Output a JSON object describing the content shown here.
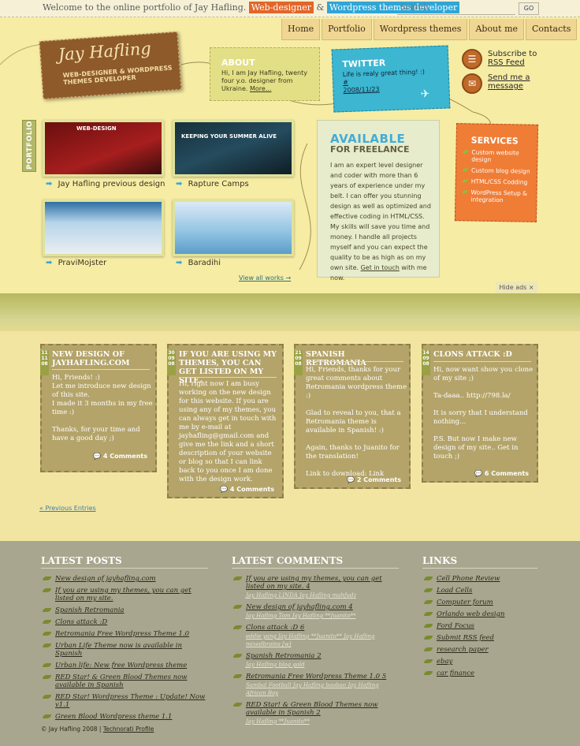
{
  "top": {
    "welcome": "Welcome to the online portfolio of Jay Hafling.",
    "role1": "Web-designer",
    "amp": "&",
    "role2": "Wordpress themes developer",
    "search_label": "Search",
    "go": "GO",
    "colors": {
      "role1": "#e2662a",
      "role2": "#2ea6d6"
    }
  },
  "nav": [
    "Home",
    "Portfolio",
    "Wordpress themes",
    "About me",
    "Contacts"
  ],
  "logo": {
    "name": "Jay Hafling",
    "tagline": "WEB-DESIGNER & WORDPRESS THEMES DEVELOPER"
  },
  "about": {
    "title": "ABOUT",
    "text": "Hi, I am Jay Hafling, twenty four y.o. designer from Ukraine.",
    "more": "More..."
  },
  "twitter": {
    "title": "TWITTER",
    "text": "Life is realy great thing! :)",
    "hash": "#",
    "date": "2008/11/23"
  },
  "rss": {
    "line1": "Subscribe to",
    "line2": "RSS Feed",
    "mail1": "Send me a",
    "mail2": "message"
  },
  "portfolio": {
    "tab": "PORTFOLIO",
    "items": [
      {
        "label": "Jay Hafling previous design"
      },
      {
        "label": "Rapture Camps"
      },
      {
        "label": "PraviMojster"
      },
      {
        "label": "Baradihi"
      }
    ],
    "view_all": "View all works"
  },
  "available": {
    "title": "AVAILABLE",
    "subtitle": "FOR FREELANCE",
    "text": "I am an expert level designer and coder with more than 6 years of experience under my belt. I can offer you stunning design as well as optimized and effective coding in HTML/CSS. My skills will save you time and money. I handle all projects myself and you can expect the quality to be as high as on my own site.",
    "link": "Get in touch",
    "after": "with me now."
  },
  "services": {
    "title": "SERVICES",
    "items": [
      "Custom website design",
      "Custom blog design",
      "HTML/CSS Codding",
      "WordPress Setup & integration"
    ]
  },
  "hide_ads": "Hide ads",
  "posts": [
    {
      "date": [
        "11",
        "11",
        "08"
      ],
      "title": "NEW DESIGN OF JAYHAFLING.COM",
      "body": [
        "Hi, Friends! :)",
        "Let me introduce new design of this site.",
        "I made it 3 months in my free time :)",
        "",
        "Thanks, for your time and have a good day ;)"
      ],
      "comments": "4 Comments"
    },
    {
      "date": [
        "30",
        "09",
        "08"
      ],
      "title": "IF YOU ARE USING MY THEMES, YOU CAN GET LISTED ON MY SITE.",
      "body": [
        "Hi, right now I am busy working on the new design for this website. If you are using any of my themes, you can always get in touch with me by e-mail at jayhafling@gmail.com and give me the link and a short description of your website or blog so that I can link back to you once I am done with the design work."
      ],
      "comments": "4 Comments"
    },
    {
      "date": [
        "21",
        "09",
        "08"
      ],
      "title": "SPANISH RETROMANIA",
      "body": [
        "Hi, Friends, thanks for your great comments about Retromania wordpress theme :)",
        "",
        "Glad to reveal to you, that a Retromania theme is available in Spanish! :)",
        "",
        "Again, thanks to Juanito for the translation!",
        "",
        "Link to download: Link"
      ],
      "comments": "2 Comments"
    },
    {
      "date": [
        "14",
        "09",
        "08"
      ],
      "title": "CLONS ATTACK :D",
      "body": [
        "Hi, now want show you clone of my site ;)",
        "",
        "Ta-daaa.. http://798.la/",
        "",
        "It is sorry that I understand nothing...",
        "",
        "P.S. But now I make new design of my site.. Get in touch ;)"
      ],
      "comments": "6 Comments"
    }
  ],
  "prev_entries": "« Previous Entries",
  "footer": {
    "latest_posts_title": "LATEST POSTS",
    "latest_posts": [
      "New design of jayhafling.com",
      "If you are using my themes, you can get listed on my site.",
      "Spanish Retromania",
      "Clons attack :D",
      "Retromania Free Wordpress Theme 1.0",
      "Urban Life Theme now is available in Spanish",
      "Urban life: New free Wordpress theme",
      "RED Star! & Green Blood Themes now available in Spanish",
      "RED Star! Wordpress Theme : Update! Now v1.1",
      "Green Blood Wordpress theme 1.1"
    ],
    "latest_comments_title": "LATEST COMMENTS",
    "latest_comments": [
      {
        "title": "If you are using my themes, you can get listed on my site.",
        "count": "4",
        "by": "Jay Hafling  LINDA  Jay Hafling  mahfudz"
      },
      {
        "title": "New design of jayhafling.com",
        "count": "4",
        "by": "Jay Hafling  Tom  Jay Hafling  **Juanito**"
      },
      {
        "title": "Clons attack :D",
        "count": "6",
        "by": "eddie yang  Jay Hafling  **Juanito**  Jay Hafling  mixedbrains  [w]"
      },
      {
        "title": "Spanish Retromania",
        "count": "2",
        "by": "Jay Hafling  blog gold"
      },
      {
        "title": "Retromania Free Wordpress Theme 1.0",
        "count": "5",
        "by": "Sambal Football  Jay Hafling  baobao  Jay Hafling  African Boy"
      },
      {
        "title": "RED Star! & Green Blood Themes now available in Spanish",
        "count": "2",
        "by": "Jay Hafling  **Juanito**"
      }
    ],
    "links_title": "LINKS",
    "links": [
      "Cell Phone Review",
      "Load Cells",
      "Computer forum",
      "Orlando web design",
      "Ford Focus",
      "Submit RSS feed",
      "research paper",
      "ebay",
      "car finance"
    ],
    "copyright": "© Jay Hafling 2008",
    "technorati": "Technorati Profile"
  }
}
